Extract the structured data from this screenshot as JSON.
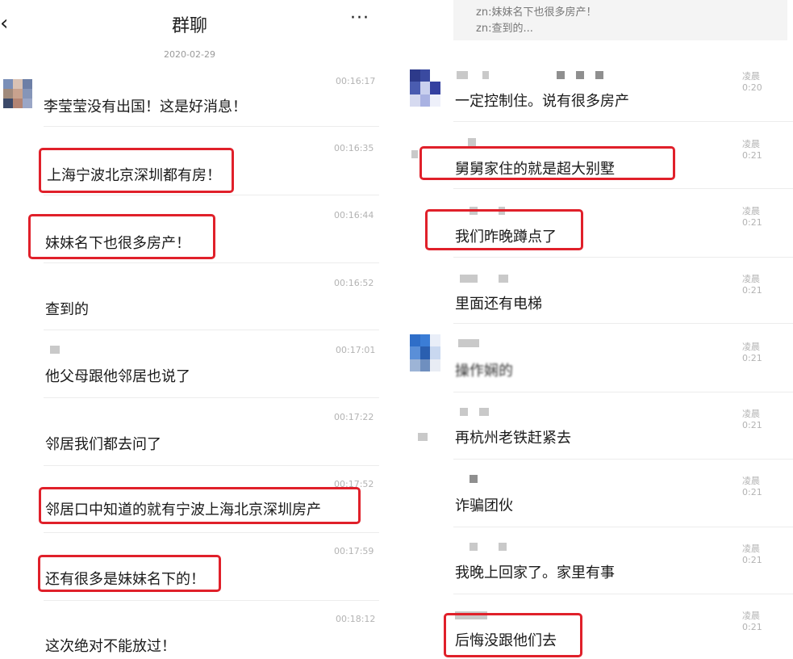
{
  "left": {
    "header": {
      "back_glyph": "‹",
      "title": "群聊",
      "more_glyph": "···"
    },
    "date": "2020-02-29",
    "messages": [
      {
        "time": "00:16:17",
        "text": "李莹莹没有出国！这是好消息！"
      },
      {
        "time": "00:16:35",
        "text": "上海宁波北京深圳都有房！"
      },
      {
        "time": "00:16:44",
        "text": "妹妹名下也很多房产！"
      },
      {
        "time": "00:16:52",
        "text": "查到的"
      },
      {
        "time": "00:17:01",
        "text": "他父母跟他邻居也说了"
      },
      {
        "time": "00:17:22",
        "text": "邻居我们都去问了"
      },
      {
        "time": "00:17:52",
        "text": "邻居口中知道的就有宁波上海北京深圳房产"
      },
      {
        "time": "00:17:59",
        "text": "还有很多是妹妹名下的！"
      },
      {
        "time": "00:18:12",
        "text": "这次绝对不能放过！"
      }
    ]
  },
  "right": {
    "quote": {
      "line1": "zn:妹妹名下也很多房产！",
      "line2": "zn:查到的..."
    },
    "messages": [
      {
        "time": "凌晨0:20",
        "text": "一定控制住。说有很多房产"
      },
      {
        "time": "凌晨0:21",
        "text": "舅舅家住的就是超大别墅"
      },
      {
        "time": "凌晨0:21",
        "text": "我们昨晚蹲点了"
      },
      {
        "time": "凌晨0:21",
        "text": "里面还有电梯"
      },
      {
        "time": "凌晨0:21",
        "text": "操作娴的"
      },
      {
        "time": "凌晨0:21",
        "text": "再杭州老铁赶紧去"
      },
      {
        "time": "凌晨0:21",
        "text": "诈骗团伙"
      },
      {
        "time": "凌晨0:21",
        "text": "我晚上回家了。家里有事"
      },
      {
        "time": "凌晨0:21",
        "text": "后悔没跟他们去"
      }
    ]
  },
  "colors": {
    "highlight": "#e0202a",
    "time": "#b3b3b3",
    "separator": "#ececec"
  }
}
